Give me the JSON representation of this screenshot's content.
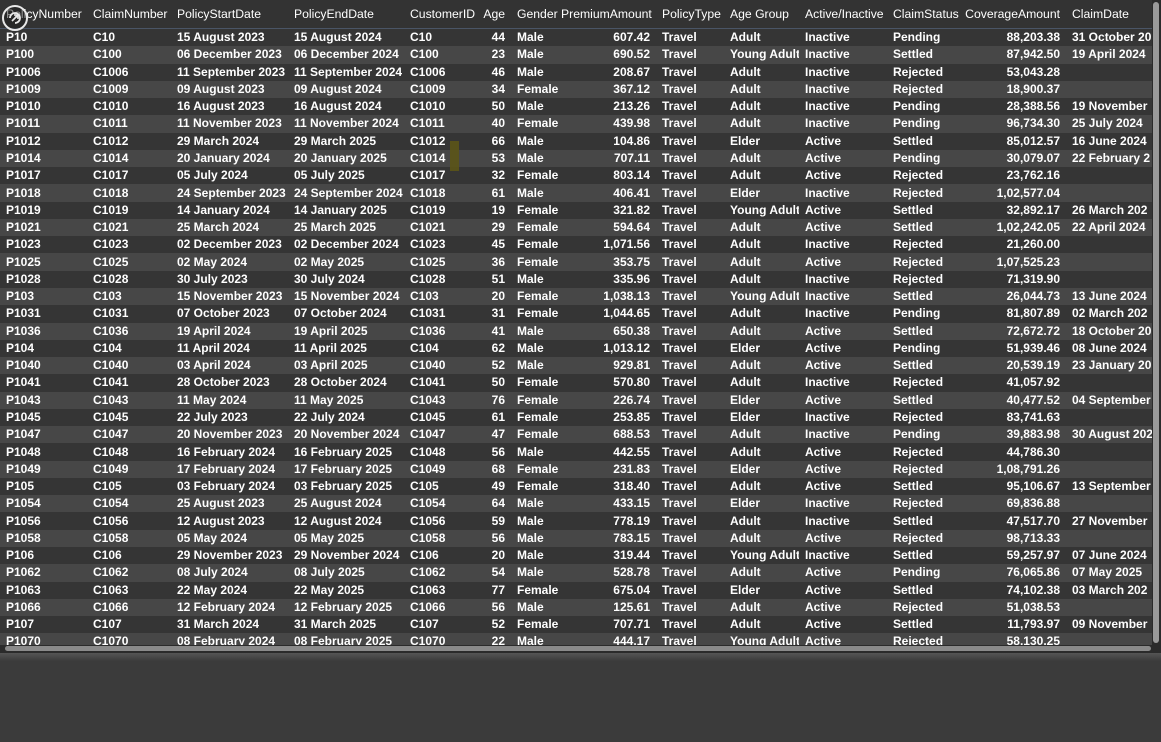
{
  "columns": [
    "PolicyNumber",
    "ClaimNumber",
    "PolicyStartDate",
    "PolicyEndDate",
    "CustomerID",
    "Age",
    "Gender",
    "PremiumAmount",
    "PolicyType",
    "Age Group",
    "Active/Inactive",
    "ClaimStatus",
    "CoverageAmount",
    "ClaimDate"
  ],
  "rows": [
    [
      "P10",
      "C10",
      "15 August 2023",
      "15 August 2024",
      "C10",
      "44",
      "Male",
      "607.42",
      "Travel",
      "Adult",
      "Inactive",
      "Pending",
      "88,203.38",
      "31 October 20"
    ],
    [
      "P100",
      "C100",
      "06 December 2023",
      "06 December 2024",
      "C100",
      "23",
      "Male",
      "690.52",
      "Travel",
      "Young Adult",
      "Inactive",
      "Settled",
      "87,942.50",
      "19 April 2024"
    ],
    [
      "P1006",
      "C1006",
      "11 September 2023",
      "11 September 2024",
      "C1006",
      "46",
      "Male",
      "208.67",
      "Travel",
      "Adult",
      "Inactive",
      "Rejected",
      "53,043.28",
      ""
    ],
    [
      "P1009",
      "C1009",
      "09 August 2023",
      "09 August 2024",
      "C1009",
      "34",
      "Female",
      "367.12",
      "Travel",
      "Adult",
      "Inactive",
      "Rejected",
      "18,900.37",
      ""
    ],
    [
      "P1010",
      "C1010",
      "16 August 2023",
      "16 August 2024",
      "C1010",
      "50",
      "Male",
      "213.26",
      "Travel",
      "Adult",
      "Inactive",
      "Pending",
      "28,388.56",
      "19 November"
    ],
    [
      "P1011",
      "C1011",
      "11 November 2023",
      "11 November 2024",
      "C1011",
      "40",
      "Female",
      "439.98",
      "Travel",
      "Adult",
      "Inactive",
      "Pending",
      "96,734.30",
      "25 July 2024"
    ],
    [
      "P1012",
      "C1012",
      "29 March 2024",
      "29 March 2025",
      "C1012",
      "66",
      "Male",
      "104.86",
      "Travel",
      "Elder",
      "Active",
      "Settled",
      "85,012.57",
      "16 June 2024"
    ],
    [
      "P1014",
      "C1014",
      "20 January 2024",
      "20 January 2025",
      "C1014",
      "53",
      "Male",
      "707.11",
      "Travel",
      "Adult",
      "Active",
      "Pending",
      "30,079.07",
      "22 February 2"
    ],
    [
      "P1017",
      "C1017",
      "05 July 2024",
      "05 July 2025",
      "C1017",
      "32",
      "Female",
      "803.14",
      "Travel",
      "Adult",
      "Active",
      "Rejected",
      "23,762.16",
      ""
    ],
    [
      "P1018",
      "C1018",
      "24 September 2023",
      "24 September 2024",
      "C1018",
      "61",
      "Male",
      "406.41",
      "Travel",
      "Elder",
      "Inactive",
      "Rejected",
      "1,02,577.04",
      ""
    ],
    [
      "P1019",
      "C1019",
      "14 January 2024",
      "14 January 2025",
      "C1019",
      "19",
      "Female",
      "321.82",
      "Travel",
      "Young Adult",
      "Active",
      "Settled",
      "32,892.17",
      "26 March 202"
    ],
    [
      "P1021",
      "C1021",
      "25 March 2024",
      "25 March 2025",
      "C1021",
      "29",
      "Female",
      "594.64",
      "Travel",
      "Adult",
      "Active",
      "Settled",
      "1,02,242.05",
      "22 April 2024"
    ],
    [
      "P1023",
      "C1023",
      "02 December 2023",
      "02 December 2024",
      "C1023",
      "45",
      "Female",
      "1,071.56",
      "Travel",
      "Adult",
      "Inactive",
      "Rejected",
      "21,260.00",
      ""
    ],
    [
      "P1025",
      "C1025",
      "02 May 2024",
      "02 May 2025",
      "C1025",
      "36",
      "Female",
      "353.75",
      "Travel",
      "Adult",
      "Active",
      "Rejected",
      "1,07,525.23",
      ""
    ],
    [
      "P1028",
      "C1028",
      "30 July 2023",
      "30 July 2024",
      "C1028",
      "51",
      "Male",
      "335.96",
      "Travel",
      "Adult",
      "Inactive",
      "Rejected",
      "71,319.90",
      ""
    ],
    [
      "P103",
      "C103",
      "15 November 2023",
      "15 November 2024",
      "C103",
      "20",
      "Female",
      "1,038.13",
      "Travel",
      "Young Adult",
      "Inactive",
      "Settled",
      "26,044.73",
      "13 June 2024"
    ],
    [
      "P1031",
      "C1031",
      "07 October 2023",
      "07 October 2024",
      "C1031",
      "31",
      "Female",
      "1,044.65",
      "Travel",
      "Adult",
      "Inactive",
      "Pending",
      "81,807.89",
      "02 March 202"
    ],
    [
      "P1036",
      "C1036",
      "19 April 2024",
      "19 April 2025",
      "C1036",
      "41",
      "Male",
      "650.38",
      "Travel",
      "Adult",
      "Active",
      "Settled",
      "72,672.72",
      "18 October 20"
    ],
    [
      "P104",
      "C104",
      "11 April 2024",
      "11 April 2025",
      "C104",
      "62",
      "Male",
      "1,013.12",
      "Travel",
      "Elder",
      "Active",
      "Pending",
      "51,939.46",
      "08 June 2024"
    ],
    [
      "P1040",
      "C1040",
      "03 April 2024",
      "03 April 2025",
      "C1040",
      "52",
      "Male",
      "929.81",
      "Travel",
      "Adult",
      "Active",
      "Settled",
      "20,539.19",
      "23 January 20"
    ],
    [
      "P1041",
      "C1041",
      "28 October 2023",
      "28 October 2024",
      "C1041",
      "50",
      "Female",
      "570.80",
      "Travel",
      "Adult",
      "Inactive",
      "Rejected",
      "41,057.92",
      ""
    ],
    [
      "P1043",
      "C1043",
      "11 May 2024",
      "11 May 2025",
      "C1043",
      "76",
      "Female",
      "226.74",
      "Travel",
      "Elder",
      "Active",
      "Settled",
      "40,477.52",
      "04 September"
    ],
    [
      "P1045",
      "C1045",
      "22 July 2023",
      "22 July 2024",
      "C1045",
      "61",
      "Female",
      "253.85",
      "Travel",
      "Elder",
      "Inactive",
      "Rejected",
      "83,741.63",
      ""
    ],
    [
      "P1047",
      "C1047",
      "20 November 2023",
      "20 November 2024",
      "C1047",
      "47",
      "Female",
      "688.53",
      "Travel",
      "Adult",
      "Inactive",
      "Pending",
      "39,883.98",
      "30 August 202"
    ],
    [
      "P1048",
      "C1048",
      "16 February 2024",
      "16 February 2025",
      "C1048",
      "56",
      "Male",
      "442.55",
      "Travel",
      "Adult",
      "Active",
      "Rejected",
      "44,786.30",
      ""
    ],
    [
      "P1049",
      "C1049",
      "17 February 2024",
      "17 February 2025",
      "C1049",
      "68",
      "Female",
      "231.83",
      "Travel",
      "Elder",
      "Active",
      "Rejected",
      "1,08,791.26",
      ""
    ],
    [
      "P105",
      "C105",
      "03 February 2024",
      "03 February 2025",
      "C105",
      "49",
      "Female",
      "318.40",
      "Travel",
      "Adult",
      "Active",
      "Settled",
      "95,106.67",
      "13 September"
    ],
    [
      "P1054",
      "C1054",
      "25 August 2023",
      "25 August 2024",
      "C1054",
      "64",
      "Male",
      "433.15",
      "Travel",
      "Elder",
      "Inactive",
      "Rejected",
      "69,836.88",
      ""
    ],
    [
      "P1056",
      "C1056",
      "12 August 2023",
      "12 August 2024",
      "C1056",
      "59",
      "Male",
      "778.19",
      "Travel",
      "Adult",
      "Inactive",
      "Settled",
      "47,517.70",
      "27 November"
    ],
    [
      "P1058",
      "C1058",
      "05 May 2024",
      "05 May 2025",
      "C1058",
      "56",
      "Male",
      "783.15",
      "Travel",
      "Adult",
      "Active",
      "Rejected",
      "98,713.33",
      ""
    ],
    [
      "P106",
      "C106",
      "29 November 2023",
      "29 November 2024",
      "C106",
      "20",
      "Male",
      "319.44",
      "Travel",
      "Young Adult",
      "Inactive",
      "Settled",
      "59,257.97",
      "07 June 2024"
    ],
    [
      "P1062",
      "C1062",
      "08 July 2024",
      "08 July 2025",
      "C1062",
      "54",
      "Male",
      "528.78",
      "Travel",
      "Adult",
      "Active",
      "Pending",
      "76,065.86",
      "07 May 2025"
    ],
    [
      "P1063",
      "C1063",
      "22 May 2024",
      "22 May 2025",
      "C1063",
      "77",
      "Female",
      "675.04",
      "Travel",
      "Elder",
      "Active",
      "Settled",
      "74,102.38",
      "03 March 202"
    ],
    [
      "P1066",
      "C1066",
      "12 February 2024",
      "12 February 2025",
      "C1066",
      "56",
      "Male",
      "125.61",
      "Travel",
      "Adult",
      "Active",
      "Rejected",
      "51,038.53",
      ""
    ],
    [
      "P107",
      "C107",
      "31 March 2024",
      "31 March 2025",
      "C107",
      "52",
      "Female",
      "707.71",
      "Travel",
      "Adult",
      "Active",
      "Settled",
      "11,793.97",
      "09 November"
    ],
    [
      "P1070",
      "C1070",
      "08 February 2024",
      "08 February 2025",
      "C1070",
      "22",
      "Male",
      "444.17",
      "Travel",
      "Young Adult",
      "Active",
      "Rejected",
      "58,130.25",
      ""
    ]
  ],
  "numeric_columns": [
    5,
    7,
    12
  ]
}
